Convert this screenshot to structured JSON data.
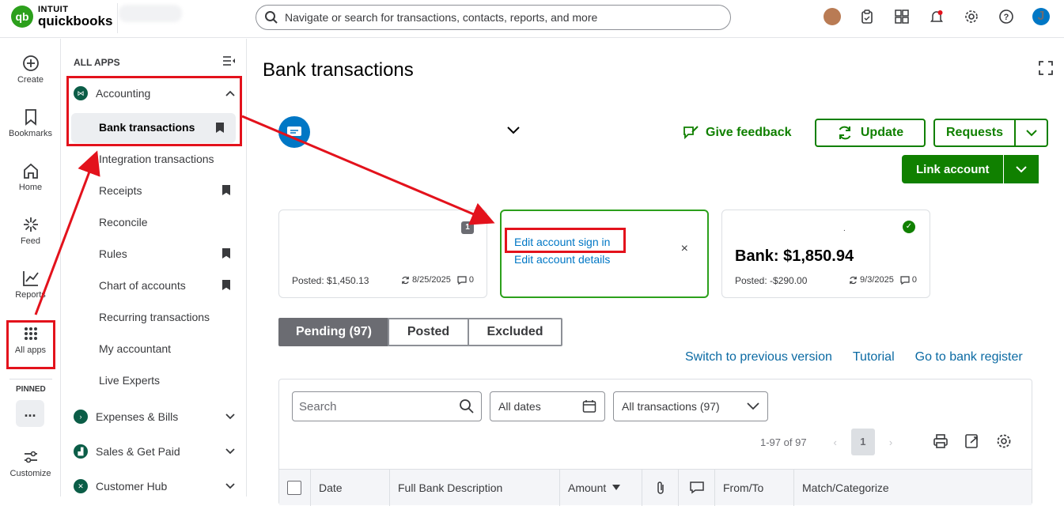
{
  "topbar": {
    "logo_line1": "INTUIT",
    "logo_line2": "quickbooks",
    "logo_mark": "qb",
    "search_placeholder": "Navigate or search for transactions, contacts, reports, and more",
    "icons": [
      "avatar-photo",
      "clipboard-icon",
      "apps-grid-icon",
      "bell-icon",
      "gear-icon",
      "help-icon"
    ],
    "user_initial": "J"
  },
  "rail": {
    "items": [
      {
        "label": "Create",
        "icon": "plus-circle-icon"
      },
      {
        "label": "Bookmarks",
        "icon": "bookmark-icon"
      },
      {
        "label": "Home",
        "icon": "home-icon"
      },
      {
        "label": "Feed",
        "icon": "sparkle-icon"
      },
      {
        "label": "Reports",
        "icon": "chart-icon"
      },
      {
        "label": "All apps",
        "icon": "dots-grid-icon"
      }
    ],
    "pinned_label": "PINNED",
    "more_label": "...",
    "customize_label": "Customize"
  },
  "appnav": {
    "title": "ALL APPS",
    "groups": [
      {
        "label": "Accounting",
        "expanded": true
      },
      {
        "label": "Expenses & Bills",
        "expanded": false
      },
      {
        "label": "Sales & Get Paid",
        "expanded": false
      },
      {
        "label": "Customer Hub",
        "expanded": false
      }
    ],
    "active_item": "Bank transactions",
    "items": [
      {
        "label": "Integration transactions",
        "bookmarked": false
      },
      {
        "label": "Receipts",
        "bookmarked": true
      },
      {
        "label": "Reconcile",
        "bookmarked": false
      },
      {
        "label": "Rules",
        "bookmarked": true
      },
      {
        "label": "Chart of accounts",
        "bookmarked": true
      },
      {
        "label": "Recurring transactions",
        "bookmarked": false
      },
      {
        "label": "My accountant",
        "bookmarked": false
      },
      {
        "label": "Live Experts",
        "bookmarked": false
      }
    ]
  },
  "main": {
    "title": "Bank transactions",
    "give_feedback": "Give feedback",
    "update_label": "Update",
    "requests_label": "Requests",
    "link_account_label": "Link account",
    "cards": [
      {
        "badge": "1",
        "posted": "Posted: $1,450.13",
        "date": "8/25/2025",
        "comments": "0"
      },
      {
        "link1": "Edit account sign in",
        "link2": "Edit account details",
        "close": "×"
      },
      {
        "dot": ".",
        "bank": "Bank: $1,850.94",
        "posted": "Posted: -$290.00",
        "date": "9/3/2025",
        "comments": "0"
      }
    ],
    "tabs": [
      "Pending (97)",
      "Posted",
      "Excluded"
    ],
    "links": [
      "Switch to previous version",
      "Tutorial",
      "Go to bank register"
    ],
    "search_placeholder": "Search",
    "dates_value": "All dates",
    "txn_filter_value": "All transactions (97)",
    "pager_text": "1-97 of 97",
    "page_number": "1",
    "columns": [
      "Date",
      "Full Bank Description",
      "Amount",
      "From/To",
      "Match/Categorize"
    ]
  },
  "colors": {
    "brand_green": "#2ca01c",
    "button_green": "#108000",
    "link_blue": "#0077c5",
    "annotation_red": "#e3121c"
  }
}
